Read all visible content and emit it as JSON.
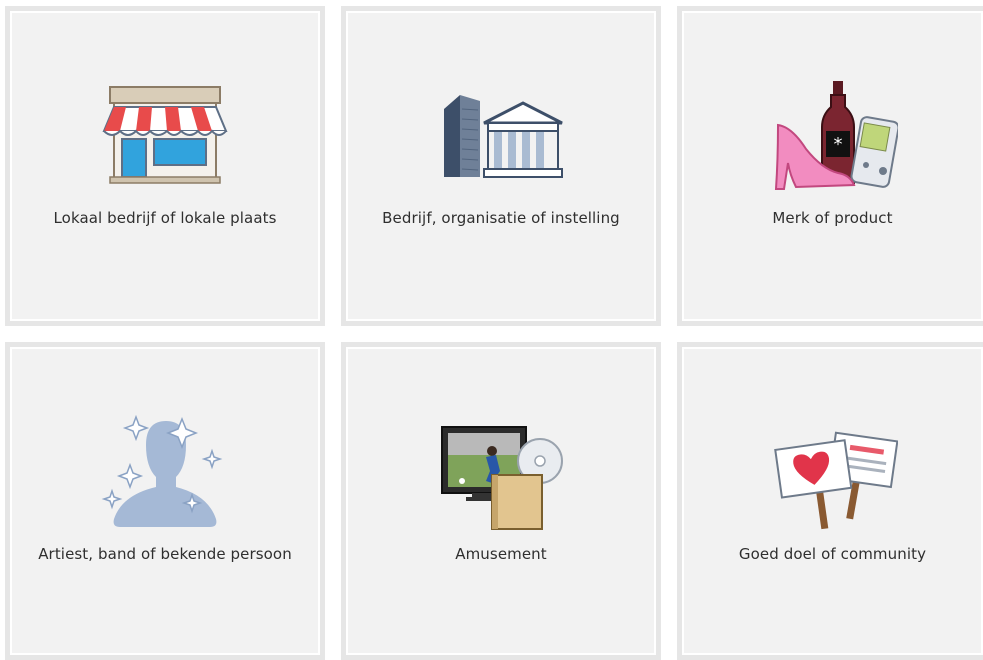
{
  "categories": [
    {
      "label": "Lokaal bedrijf of lokale plaats",
      "icon": "storefront-icon"
    },
    {
      "label": "Bedrijf, organisatie of instelling",
      "icon": "buildings-icon"
    },
    {
      "label": "Merk of product",
      "icon": "products-icon"
    },
    {
      "label": "Artiest, band of bekende persoon",
      "icon": "person-silhouette-icon"
    },
    {
      "label": "Amusement",
      "icon": "entertainment-icon"
    },
    {
      "label": "Goed doel of community",
      "icon": "signs-heart-icon"
    }
  ]
}
